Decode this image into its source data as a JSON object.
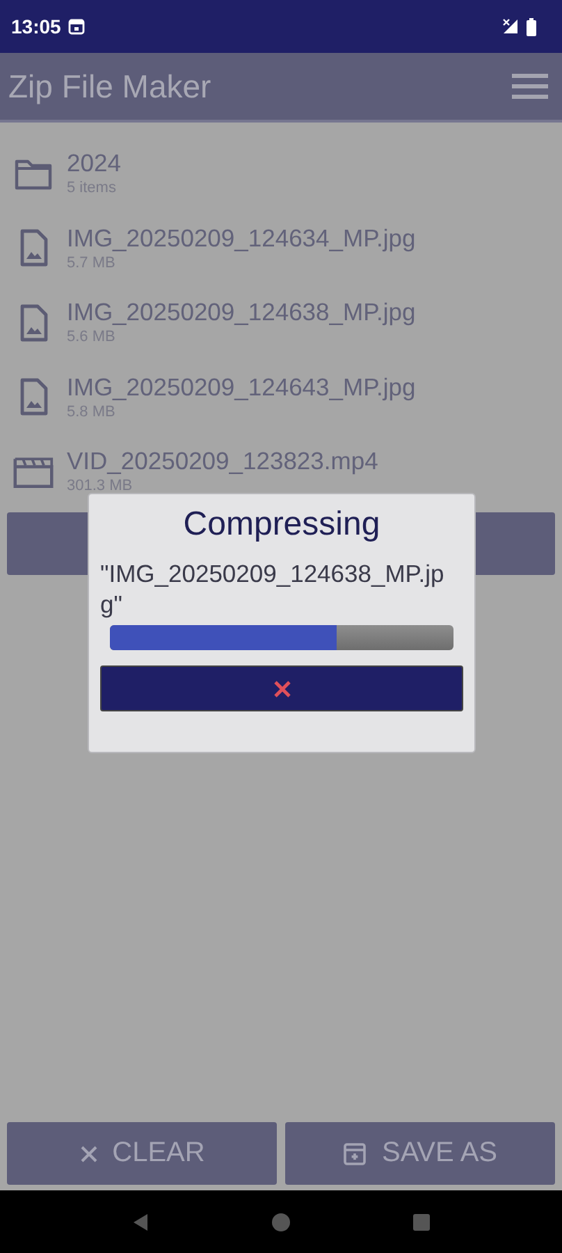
{
  "status_bar": {
    "time": "13:05"
  },
  "app_bar": {
    "title": "Zip File Maker"
  },
  "files": [
    {
      "kind": "folder",
      "name": "2024",
      "detail": "5 items"
    },
    {
      "kind": "image",
      "name": "IMG_20250209_124634_MP.jpg",
      "detail": "5.7 MB"
    },
    {
      "kind": "image",
      "name": "IMG_20250209_124638_MP.jpg",
      "detail": "5.6 MB"
    },
    {
      "kind": "image",
      "name": "IMG_20250209_124643_MP.jpg",
      "detail": "5.8 MB"
    },
    {
      "kind": "video",
      "name": "VID_20250209_123823.mp4",
      "detail": "301.3 MB"
    }
  ],
  "dialog": {
    "title": "Compressing",
    "message": "\"IMG_20250209_124638_MP.jpg\"",
    "level": 0.66
  },
  "buttons": [
    {
      "kind": "clear",
      "label": "CLEAR"
    },
    {
      "kind": "save",
      "label": "SAVE AS"
    }
  ]
}
